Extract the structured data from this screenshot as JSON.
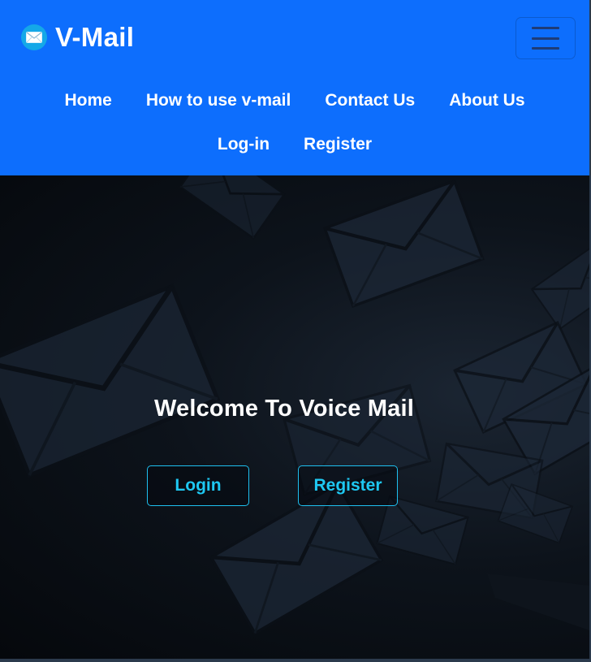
{
  "brand": {
    "name": "V-Mail",
    "logo_icon": "envelope-icon"
  },
  "navbar": {
    "toggler_icon": "hamburger-menu-icon",
    "links": [
      {
        "label": "Home"
      },
      {
        "label": "How to use v-mail"
      },
      {
        "label": "Contact Us"
      },
      {
        "label": "About Us"
      },
      {
        "label": "Log-in"
      },
      {
        "label": "Register"
      }
    ],
    "background_color": "#0d6efd"
  },
  "hero": {
    "title": "Welcome To Voice Mail",
    "login_button": "Login",
    "register_button": "Register",
    "accent_color": "#1ec8f2"
  }
}
